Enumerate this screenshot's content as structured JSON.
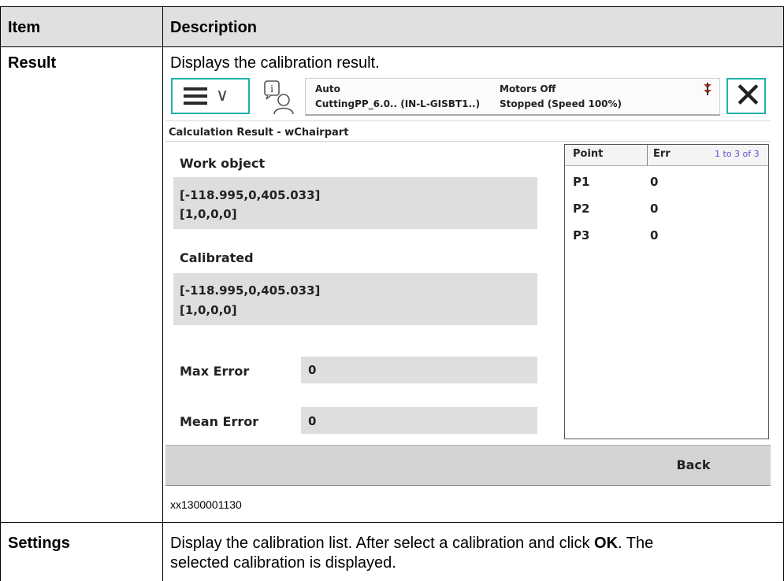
{
  "table": {
    "headers": [
      "Item",
      "Description"
    ],
    "rows": [
      {
        "item": "Result",
        "description": "Displays the calibration result.",
        "figure_id": "xx1300001130"
      },
      {
        "item": "Settings",
        "description_line1_pre": "Display the calibration list. After select a calibration and click ",
        "description_line1_bold": "OK",
        "description_line1_post": ". The",
        "description_line2": "selected calibration is displayed."
      }
    ]
  },
  "screen": {
    "status": {
      "mode": "Auto",
      "program": "CuttingPP_6.0.. (IN-L-GISBT1..)",
      "motors": "Motors Off",
      "state": "Stopped (Speed 100%)"
    },
    "title": "Calculation Result - wChairpart",
    "work_object": {
      "label": "Work object",
      "line1": "[-118.995,0,405.033]",
      "line2": "[1,0,0,0]"
    },
    "calibrated": {
      "label": "Calibrated",
      "line1": "[-118.995,0,405.033]",
      "line2": "[1,0,0,0]"
    },
    "max_error": {
      "label": "Max Error",
      "value": "0"
    },
    "mean_error": {
      "label": "Mean Error",
      "value": "0"
    },
    "points_table": {
      "col_point": "Point",
      "col_err": "Err",
      "count": "1 to 3 of 3",
      "rows": [
        {
          "point": "P1",
          "err": "0"
        },
        {
          "point": "P2",
          "err": "0"
        },
        {
          "point": "P3",
          "err": "0"
        }
      ]
    },
    "back_label": "Back",
    "accent_color": "#20b2aa"
  }
}
